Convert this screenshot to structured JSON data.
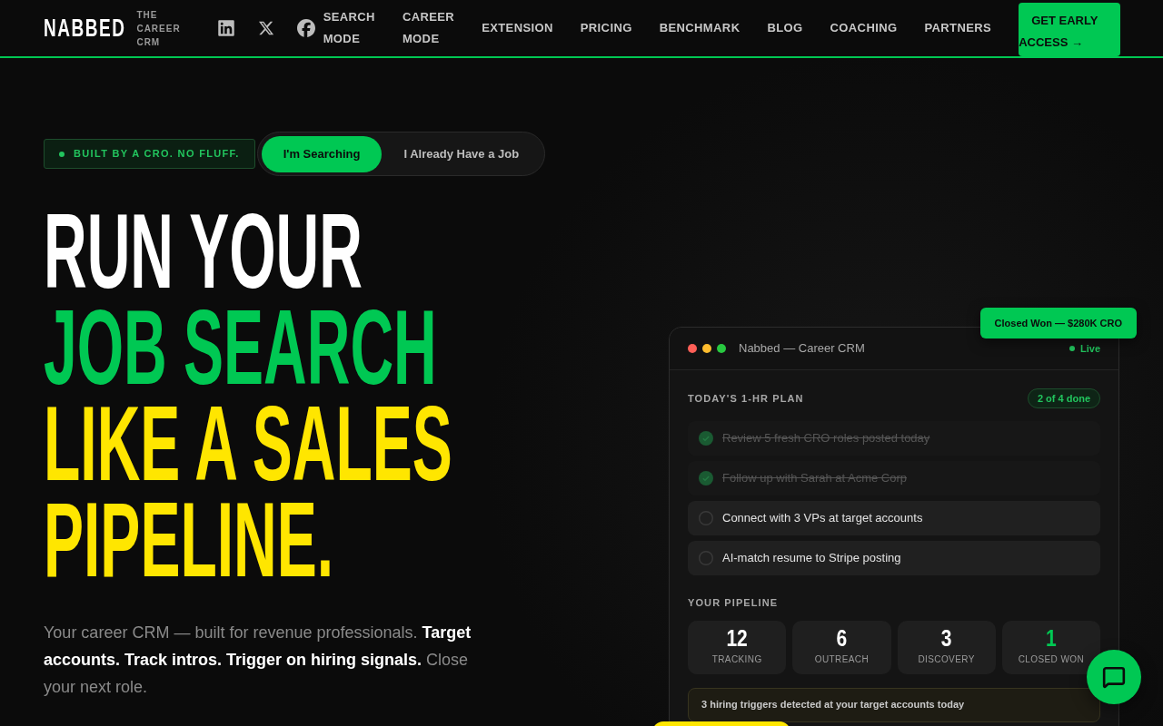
{
  "header": {
    "logo": "NABBED",
    "tagline": "THE CAREER CRM",
    "nav": [
      "SEARCH MODE",
      "CAREER MODE",
      "EXTENSION",
      "PRICING",
      "BENCHMARK",
      "BLOG",
      "COACHING",
      "PARTNERS"
    ],
    "cta": "GET EARLY ACCESS →"
  },
  "hero": {
    "badge": "BUILT BY A CRO. NO FLUFF.",
    "mode_toggle": [
      {
        "label": "I'm Searching",
        "selected": true
      },
      {
        "label": "I Already Have a Job",
        "selected": false
      }
    ],
    "headline": [
      {
        "text": "RUN YOUR",
        "color": "#ffffff"
      },
      {
        "text": "JOB SEARCH",
        "color": "#00c853"
      },
      {
        "text": "LIKE A SALES PIPELINE.",
        "color": "#ffe600"
      }
    ],
    "subtitle": "Your career CRM — built for revenue professionals. **Target accounts. Track intros. Trigger on hiring signals.** Close your next role."
  },
  "crm_window": {
    "badge": "Closed Won — $280K CRO",
    "title": "Nabbed — Career CRM",
    "status": "Live",
    "plan": {
      "heading": "TODAY'S 1-HR PLAN",
      "progress": "2 of 4 done",
      "tasks": [
        {
          "text": "Review 5 fresh CRO roles posted today",
          "done": true
        },
        {
          "text": "Follow up with Sarah at Acme Corp",
          "done": true
        },
        {
          "text": "Connect with 3 VPs at target accounts",
          "done": false
        },
        {
          "text": "AI-match resume to Stripe posting",
          "done": false
        }
      ]
    },
    "pipeline": {
      "heading": "YOUR PIPELINE",
      "stages": [
        {
          "value": "12",
          "label": "TRACKING",
          "color": "#ffffff"
        },
        {
          "value": "6",
          "label": "OUTREACH",
          "color": "#ffffff"
        },
        {
          "value": "3",
          "label": "DISCOVERY",
          "color": "#ffffff"
        },
        {
          "value": "1",
          "label": "CLOSED WON",
          "color": "#00c853"
        }
      ]
    },
    "alert": "3 hiring triggers detected at your target accounts today"
  }
}
